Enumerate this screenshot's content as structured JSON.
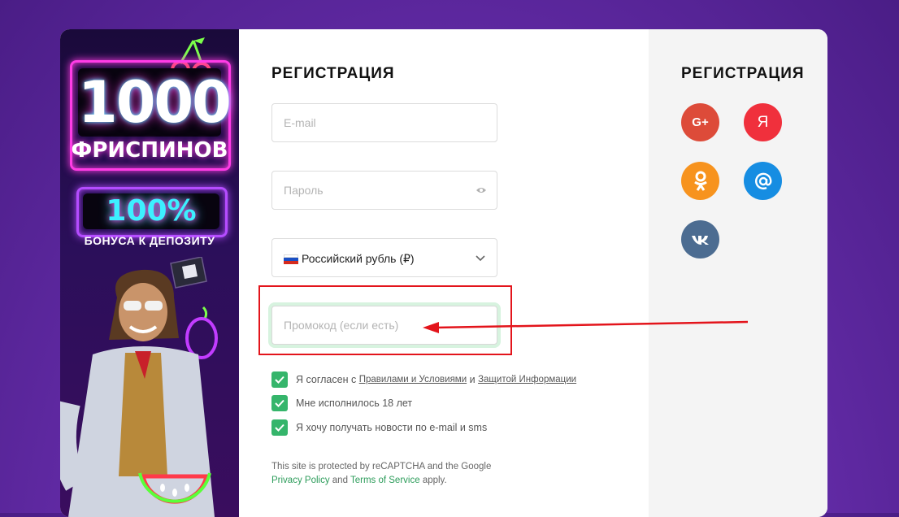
{
  "promo": {
    "amount": "1000",
    "freespins": "ФРИСПИНОВ",
    "percent": "100%",
    "bonus": "БОНУСА К ДЕПОЗИТУ"
  },
  "form": {
    "title": "РЕГИСТРАЦИЯ",
    "email_placeholder": "E-mail",
    "password_placeholder": "Пароль",
    "currency_selected": "Российский рубль (₽)",
    "promo_placeholder": "Промокод (если есть)",
    "checks": {
      "terms_prefix": "Я согласен с",
      "terms_link": "Правилами и Условиями",
      "terms_and": "и",
      "privacy_link": "Защитой Информации",
      "age": "Мне исполнилось 18 лет",
      "news": "Я хочу получать новости по e-mail и sms"
    },
    "captcha": {
      "text1": "This site is protected by reCAPTCHA and the Google",
      "privacy": "Privacy Policy",
      "and": "and",
      "terms": "Terms of Service",
      "apply": "apply."
    }
  },
  "social": {
    "title": "РЕГИСТРАЦИЯ",
    "google": "G+",
    "yandex": "Я",
    "colors": {
      "google": "#dd4b39",
      "yandex": "#f0303c",
      "ok": "#f7931e",
      "mail": "#168de2",
      "vk": "#4c6c91"
    }
  },
  "accent": {
    "checkbox": "#35b56b",
    "annotation": "#e3141b"
  }
}
